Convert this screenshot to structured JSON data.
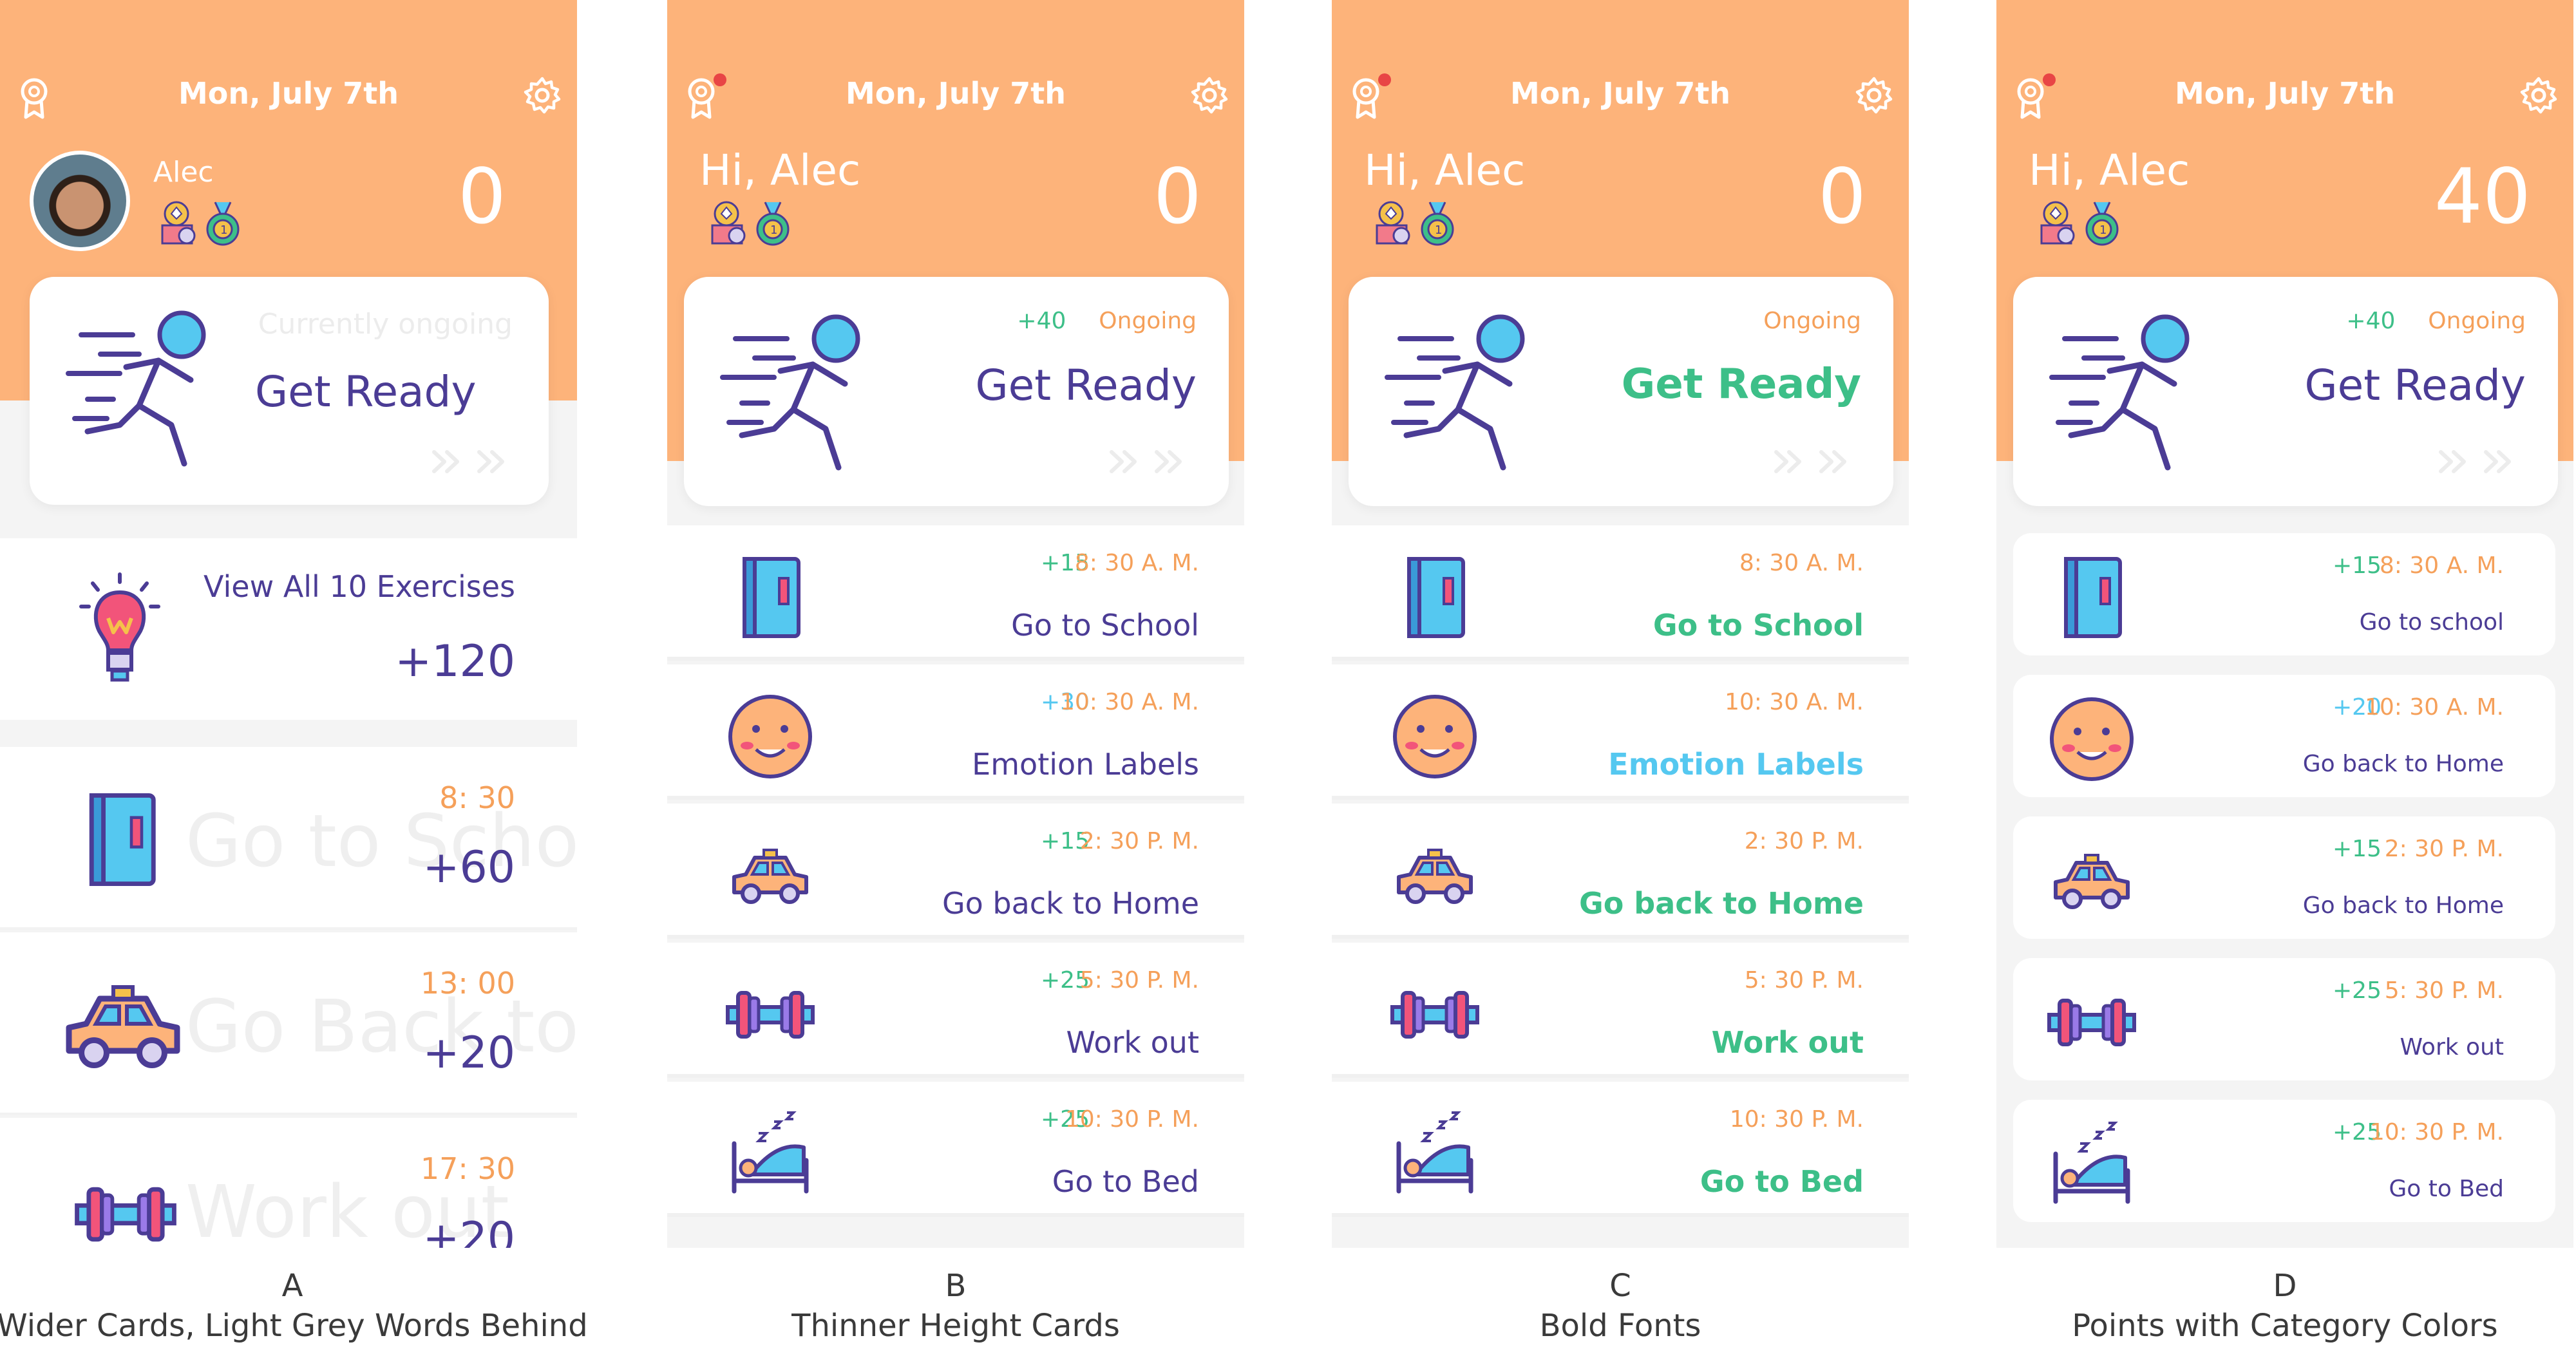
{
  "screens": [
    {
      "date": "Mon, July 7th",
      "greeting": "Alec",
      "score": "0",
      "get_ready": {
        "title": "Get Ready",
        "status": "Currently ongoing"
      },
      "view_all": {
        "label": "View All 10 Exercises",
        "points": "+120"
      },
      "tasks": [
        {
          "time": "8: 30",
          "points": "+60",
          "ghost": "Go to Scho"
        },
        {
          "time": "13: 00",
          "points": "+20",
          "ghost": "Go Back to"
        },
        {
          "time": "17: 30",
          "points": "+20",
          "ghost": "Work out"
        }
      ],
      "caption_letter": "A",
      "caption_text": "Wider Cards, Light Grey Words Behind"
    },
    {
      "date": "Mon, July 7th",
      "greeting": "Hi, Alec",
      "score": "0",
      "get_ready": {
        "title": "Get Ready",
        "points": "+40",
        "status": "Ongoing"
      },
      "tasks": [
        {
          "points": "+15",
          "time": "8: 30 A. M.",
          "name": "Go to School",
          "icon": "book-icon"
        },
        {
          "points": "+30",
          "time": "10: 30 A. M.",
          "name": "Emotion Labels",
          "icon": "smiley-face-icon"
        },
        {
          "points": "+15",
          "time": "2: 30 P. M.",
          "name": "Go back to Home",
          "icon": "car-icon"
        },
        {
          "points": "+25",
          "time": "5: 30 P. M.",
          "name": "Work out",
          "icon": "dumbbell-icon"
        },
        {
          "points": "+25",
          "time": "10: 30 P. M.",
          "name": "Go to Bed",
          "icon": "bed-icon"
        }
      ],
      "caption_letter": "B",
      "caption_text": "Thinner Height Cards"
    },
    {
      "date": "Mon, July 7th",
      "greeting": "Hi, Alec",
      "score": "0",
      "get_ready": {
        "title": "Get Ready",
        "status": "Ongoing"
      },
      "tasks": [
        {
          "time": "8: 30 A. M.",
          "name": "Go to School",
          "icon": "book-icon"
        },
        {
          "time": "10: 30 A. M.",
          "name": "Emotion Labels",
          "icon": "smiley-face-icon"
        },
        {
          "time": "2: 30 P. M.",
          "name": "Go back to Home",
          "icon": "car-icon"
        },
        {
          "time": "5: 30 P. M.",
          "name": "Work out",
          "icon": "dumbbell-icon"
        },
        {
          "time": "10: 30 P. M.",
          "name": "Go to Bed",
          "icon": "bed-icon"
        }
      ],
      "caption_letter": "C",
      "caption_text": "Bold Fonts"
    },
    {
      "date": "Mon, July 7th",
      "greeting": "Hi, Alec",
      "score": "40",
      "get_ready": {
        "title": "Get Ready",
        "points": "+40",
        "status": "Ongoing"
      },
      "tasks": [
        {
          "points": "+15",
          "time": "8: 30 A. M.",
          "name": "Go to school",
          "icon": "book-icon"
        },
        {
          "points": "+20",
          "time": "10: 30 A. M.",
          "name": "Go back to Home",
          "icon": "smiley-face-icon"
        },
        {
          "points": "+15",
          "time": "2: 30 P. M.",
          "name": "Go back to Home",
          "icon": "car-icon"
        },
        {
          "points": "+25",
          "time": "5: 30 P. M.",
          "name": "Work out",
          "icon": "dumbbell-icon"
        },
        {
          "points": "+25",
          "time": "10: 30 P. M.",
          "name": "Go to Bed",
          "icon": "bed-icon"
        }
      ],
      "caption_letter": "D",
      "caption_text": "Points with Category Colors"
    }
  ],
  "colors": {
    "header": "#fdb37a",
    "purple": "#4b3c95",
    "green": "#3dbf88",
    "blue": "#55c8f0",
    "orange": "#f5a05a"
  }
}
